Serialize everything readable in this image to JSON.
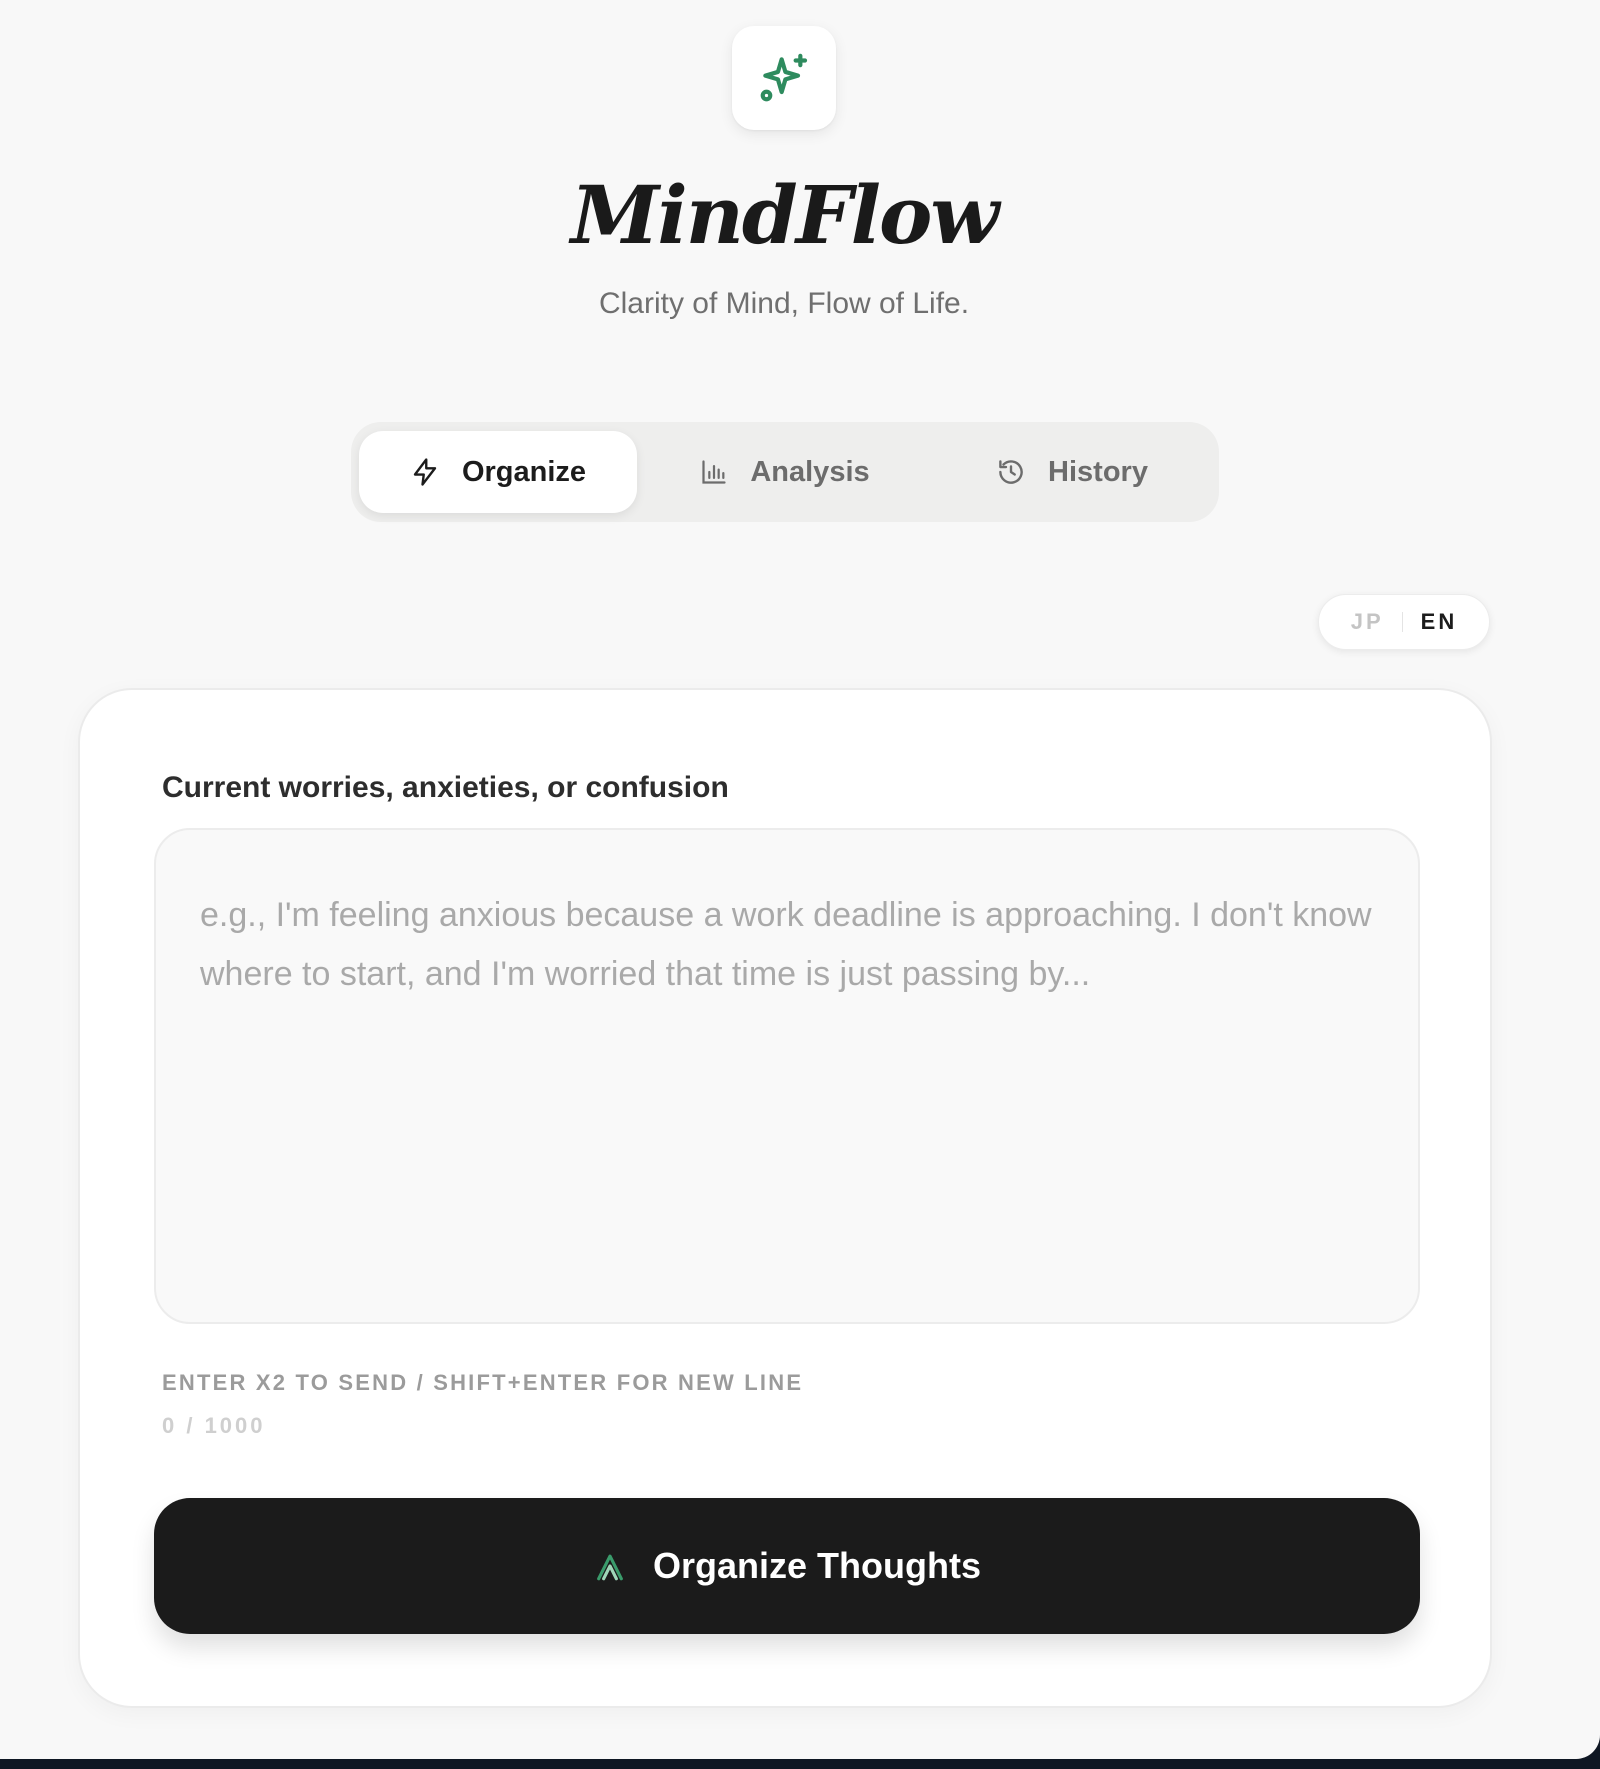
{
  "app": {
    "title": "MindFlow",
    "tagline": "Clarity of Mind, Flow of Life.",
    "logo_icon": "sparkles-icon",
    "accent_color": "#2e8b5e"
  },
  "tabs": [
    {
      "label": "Organize",
      "icon": "lightning-icon",
      "active": true
    },
    {
      "label": "Analysis",
      "icon": "bar-chart-icon",
      "active": false
    },
    {
      "label": "History",
      "icon": "history-icon",
      "active": false
    }
  ],
  "language": {
    "options": [
      "JP",
      "EN"
    ],
    "selected": "EN"
  },
  "form": {
    "label": "Current worries, anxieties, or confusion",
    "value": "",
    "placeholder": "e.g., I'm feeling anxious because a work deadline is approaching. I don't know where to start, and I'm worried that time is just passing by...",
    "hint": "ENTER X2 TO SEND / SHIFT+ENTER FOR NEW LINE",
    "counter": "0 / 1000",
    "submit_label": "Organize Thoughts",
    "submit_icon": "double-chevron-up-icon"
  }
}
